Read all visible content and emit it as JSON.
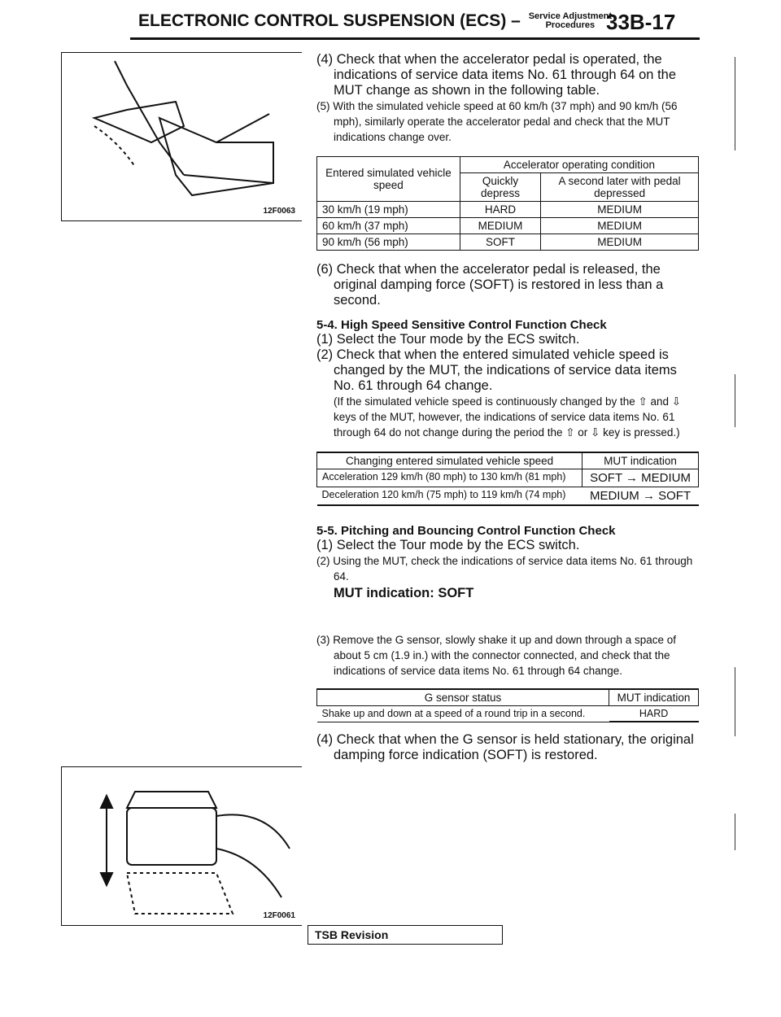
{
  "header": {
    "title": "ELECTRONIC CONTROL SUSPENSION (ECS)",
    "dash": "–",
    "subtitle_line1": "Service Adjustment",
    "subtitle_line2": "Procedures",
    "page_number": "33B-17"
  },
  "figures": [
    {
      "label": "12F0063",
      "icon": "accelerator-pedal-illustration"
    },
    {
      "label": "12F0061",
      "icon": "g-sensor-illustration"
    }
  ],
  "steps_a": [
    "(4) Check that when the accelerator pedal is operated, the indications of service data items No. 61 through 64 on the MUT change as shown in the following table.",
    "(5) With the simulated vehicle speed at 60 km/h (37 mph) and 90 km/h (56 mph), similarly operate the accelerator pedal and check that the MUT indications change over."
  ],
  "table1": {
    "col1": "Entered simulated vehicle speed",
    "group": "Accelerator operating condition",
    "col2": "Quickly depress",
    "col3": "A second later with pedal depressed",
    "rows": [
      [
        "30 km/h (19 mph)",
        "HARD",
        "MEDIUM"
      ],
      [
        "60 km/h (37 mph)",
        "MEDIUM",
        "MEDIUM"
      ],
      [
        "90 km/h (56 mph)",
        "SOFT",
        "MEDIUM"
      ]
    ]
  },
  "step6": "(6) Check that when the accelerator pedal is released, the original damping force (SOFT) is restored in less than a second.",
  "sec54": {
    "title": "5-4. High Speed Sensitive Control Function Check",
    "s1": "(1) Select the Tour mode by the ECS switch.",
    "s2": "(2) Check that when the entered simulated vehicle speed is changed by the MUT, the indications of service data items No. 61 through 64 change.",
    "note": "(If the simulated vehicle speed is continuously changed by the ⇧ and ⇩ keys of the MUT, however, the indications of service data items No. 61 through 64 do not change during the period the ⇧ or ⇩ key is pressed.)"
  },
  "table2": {
    "col1": "Changing entered simulated vehicle speed",
    "col2": "MUT indication",
    "rows": [
      [
        "Acceleration 129 km/h (80 mph) to 130 km/h (81 mph)",
        "SOFT → MEDIUM"
      ],
      [
        "Deceleration 120 km/h (75 mph) to 119 km/h (74 mph)",
        "MEDIUM → SOFT"
      ]
    ]
  },
  "sec55": {
    "title": "5-5. Pitching and Bouncing Control Function Check",
    "s1": "(1) Select the Tour mode by the ECS switch.",
    "s2": "(2) Using the MUT, check the indications of service data items No. 61 through 64.",
    "result": "MUT indication: SOFT",
    "s3": "(3) Remove the G sensor, slowly shake it up and down through a space of about 5 cm (1.9 in.) with the connector connected, and check that the indications of service data items No. 61 through 64 change."
  },
  "table3": {
    "col1": "G sensor status",
    "col2": "MUT indication",
    "rows": [
      [
        "Shake up and down at a speed of a round trip in a second.",
        "HARD"
      ]
    ]
  },
  "step4b": "(4) Check that when the G sensor is held stationary, the original damping force indication (SOFT) is restored.",
  "footer": {
    "tsb": "TSB Revision"
  }
}
